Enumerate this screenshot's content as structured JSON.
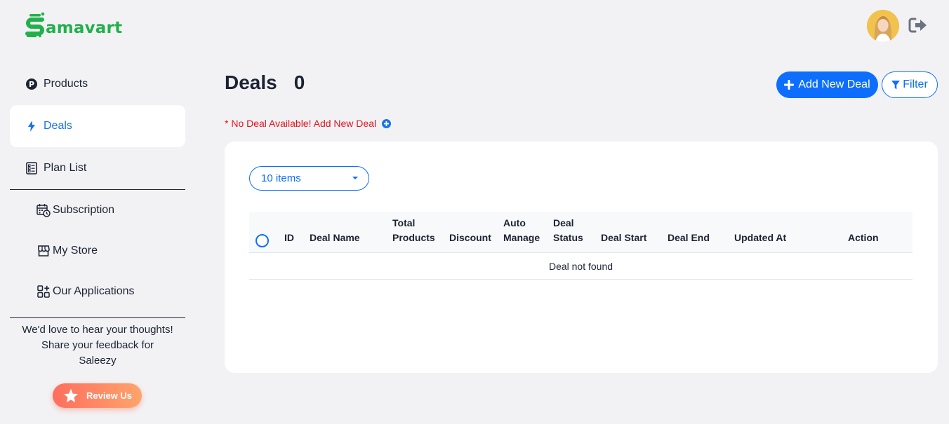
{
  "brand": {
    "name": "amavart"
  },
  "sidebar": {
    "main_items": [
      {
        "label": "Products",
        "icon": "products-p-icon"
      },
      {
        "label": "Deals",
        "icon": "bolt-icon",
        "active": true
      },
      {
        "label": "Plan List",
        "icon": "plan-list-icon"
      }
    ],
    "sub_items": [
      {
        "label": "Subscription",
        "icon": "calendar-clock-icon"
      },
      {
        "label": "My Store",
        "icon": "store-icon"
      },
      {
        "label": "Our Applications",
        "icon": "apps-grid-icon"
      }
    ],
    "feedback": {
      "line1": "We'd love to hear your thoughts!",
      "line2": "Share your feedback for",
      "line3": "Saleezy"
    },
    "review_label": "Review Us"
  },
  "main": {
    "title": "Deals",
    "count": "0",
    "add_label": "Add New Deal",
    "filter_label": "Filter",
    "notice": "* No Deal Available! Add New Deal",
    "items_select": "10 items",
    "table": {
      "headers": {
        "id": "ID",
        "deal_name": "Deal Name",
        "total_products_1": "Total",
        "total_products_2": "Products",
        "discount": "Discount",
        "auto_manage_1": "Auto",
        "auto_manage_2": "Manage",
        "deal_status_1": "Deal",
        "deal_status_2": "Status",
        "deal_start": "Deal Start",
        "deal_end": "Deal End",
        "updated_at": "Updated At",
        "action": "Action"
      },
      "empty": "Deal not found"
    }
  },
  "colors": {
    "brand_green": "#22b04b",
    "primary_blue": "#0d6efd",
    "error_red": "#e5131d",
    "review_gradient_start": "#fe6e5e",
    "review_gradient_end": "#ffa46c"
  }
}
